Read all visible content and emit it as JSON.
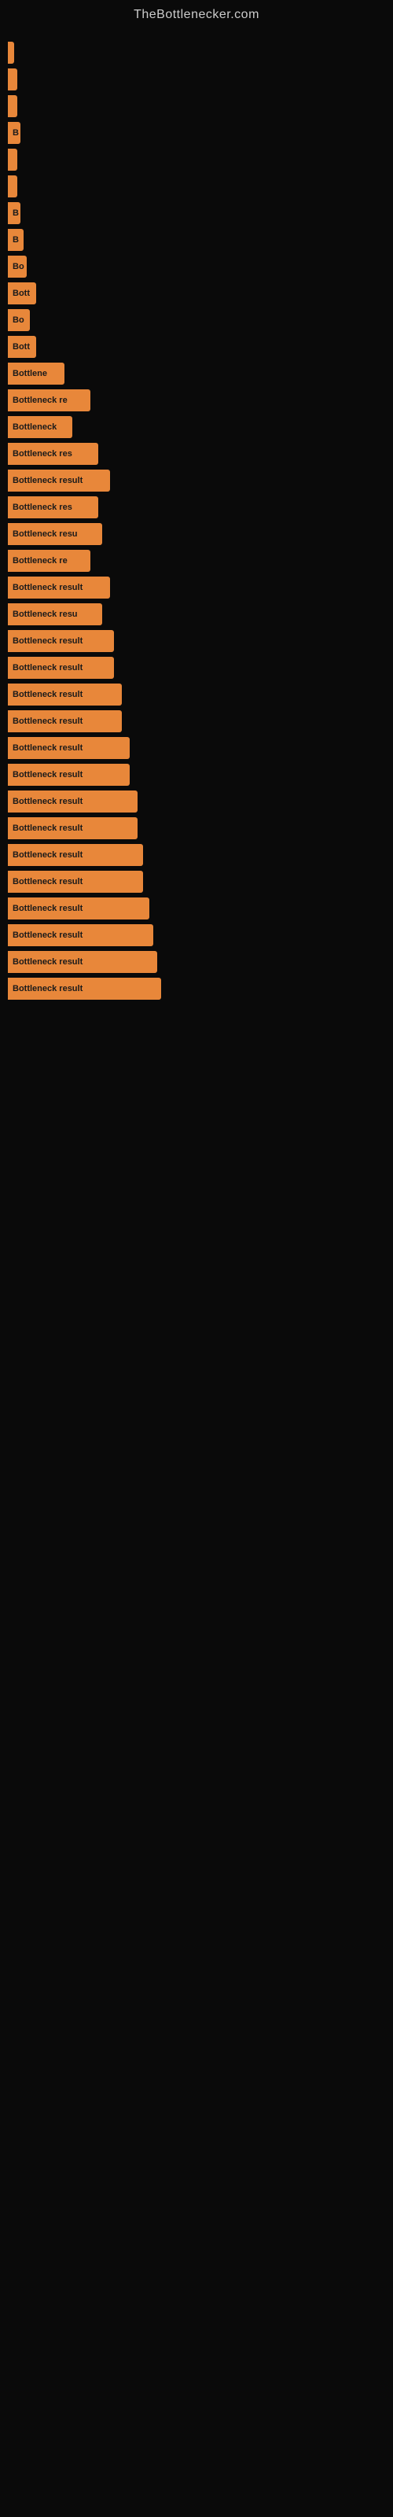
{
  "header": {
    "site_title": "TheBottlenecker.com"
  },
  "bars": [
    {
      "label": "",
      "width": 8
    },
    {
      "label": "",
      "width": 12
    },
    {
      "label": "",
      "width": 12
    },
    {
      "label": "B",
      "width": 16
    },
    {
      "label": "",
      "width": 12
    },
    {
      "label": "",
      "width": 12
    },
    {
      "label": "B",
      "width": 16
    },
    {
      "label": "B",
      "width": 20
    },
    {
      "label": "Bo",
      "width": 24
    },
    {
      "label": "Bott",
      "width": 36
    },
    {
      "label": "Bo",
      "width": 28
    },
    {
      "label": "Bott",
      "width": 36
    },
    {
      "label": "Bottlene",
      "width": 72
    },
    {
      "label": "Bottleneck re",
      "width": 105
    },
    {
      "label": "Bottleneck",
      "width": 82
    },
    {
      "label": "Bottleneck res",
      "width": 115
    },
    {
      "label": "Bottleneck result",
      "width": 130
    },
    {
      "label": "Bottleneck res",
      "width": 115
    },
    {
      "label": "Bottleneck resu",
      "width": 120
    },
    {
      "label": "Bottleneck re",
      "width": 105
    },
    {
      "label": "Bottleneck result",
      "width": 130
    },
    {
      "label": "Bottleneck resu",
      "width": 120
    },
    {
      "label": "Bottleneck result",
      "width": 135
    },
    {
      "label": "Bottleneck result",
      "width": 135
    },
    {
      "label": "Bottleneck result",
      "width": 145
    },
    {
      "label": "Bottleneck result",
      "width": 145
    },
    {
      "label": "Bottleneck result",
      "width": 155
    },
    {
      "label": "Bottleneck result",
      "width": 155
    },
    {
      "label": "Bottleneck result",
      "width": 165
    },
    {
      "label": "Bottleneck result",
      "width": 165
    },
    {
      "label": "Bottleneck result",
      "width": 172
    },
    {
      "label": "Bottleneck result",
      "width": 172
    },
    {
      "label": "Bottleneck result",
      "width": 180
    },
    {
      "label": "Bottleneck result",
      "width": 185
    },
    {
      "label": "Bottleneck result",
      "width": 190
    },
    {
      "label": "Bottleneck result",
      "width": 195
    }
  ]
}
